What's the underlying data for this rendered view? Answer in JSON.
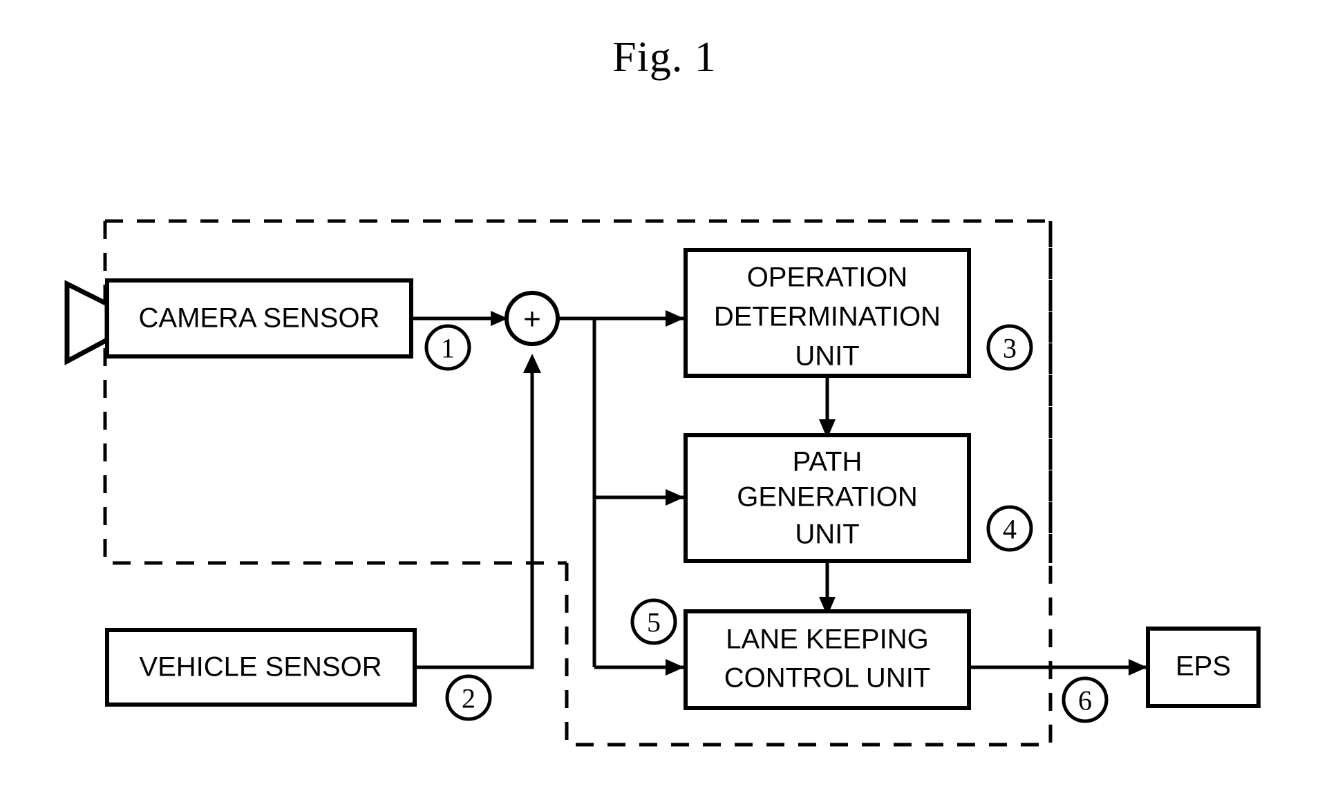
{
  "figure": {
    "title": "Fig. 1",
    "type": "block-diagram",
    "caption_position": "top-center"
  },
  "colors": {
    "stroke": "#000000",
    "background": "#ffffff",
    "fill": "#ffffff"
  },
  "blocks": {
    "camera_sensor": {
      "label": "CAMERA SENSOR",
      "ref": "1",
      "icon": "camera-lens-icon"
    },
    "vehicle_sensor": {
      "label": "VEHICLE SENSOR",
      "ref": "2"
    },
    "operation_determination_unit": {
      "label_line1": "OPERATION",
      "label_line2": "DETERMINATION",
      "label_line3": "UNIT",
      "ref": "3"
    },
    "path_generation_unit": {
      "label_line1": "PATH",
      "label_line2": "GENERATION",
      "label_line3": "UNIT",
      "ref": "4"
    },
    "lane_keeping_control_unit": {
      "label_line1": "LANE KEEPING",
      "label_line2": "CONTROL UNIT",
      "ref": "5"
    },
    "eps": {
      "label": "EPS",
      "ref": "6"
    }
  },
  "junction": {
    "symbol": "+",
    "name": "summing-junction"
  },
  "reference_numerals": [
    "1",
    "2",
    "3",
    "4",
    "5",
    "6"
  ],
  "dashed_regions": [
    {
      "name": "sensing-region"
    },
    {
      "name": "control-region"
    }
  ]
}
